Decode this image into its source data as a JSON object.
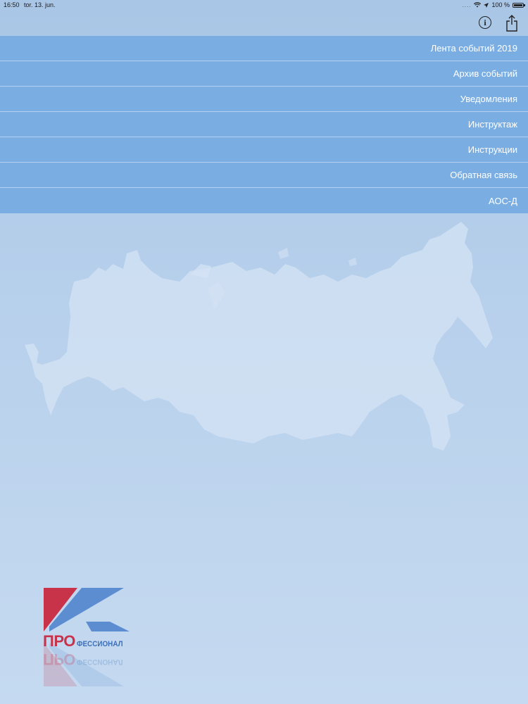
{
  "status_bar": {
    "time": "16:50",
    "date": "tor. 13. jun.",
    "signal": "....",
    "battery_text": "100 %",
    "battery_level": 1.0
  },
  "nav": {
    "info_icon": "info-circle-icon",
    "share_icon": "share-icon"
  },
  "menu": {
    "items": [
      {
        "label": "Лента событий 2019"
      },
      {
        "label": "Архив событий"
      },
      {
        "label": "Уведомления"
      },
      {
        "label": "Инструктаж"
      },
      {
        "label": "Инструкции"
      },
      {
        "label": "Обратная связь"
      },
      {
        "label": "АОС-Д"
      }
    ]
  },
  "logo": {
    "pro": "ПРО",
    "rest": "ФЕССИОНАЛ"
  },
  "colors": {
    "menu_bg": "#7aaee3",
    "logo_red": "#c8334a",
    "logo_blue": "#3c6fb8"
  }
}
